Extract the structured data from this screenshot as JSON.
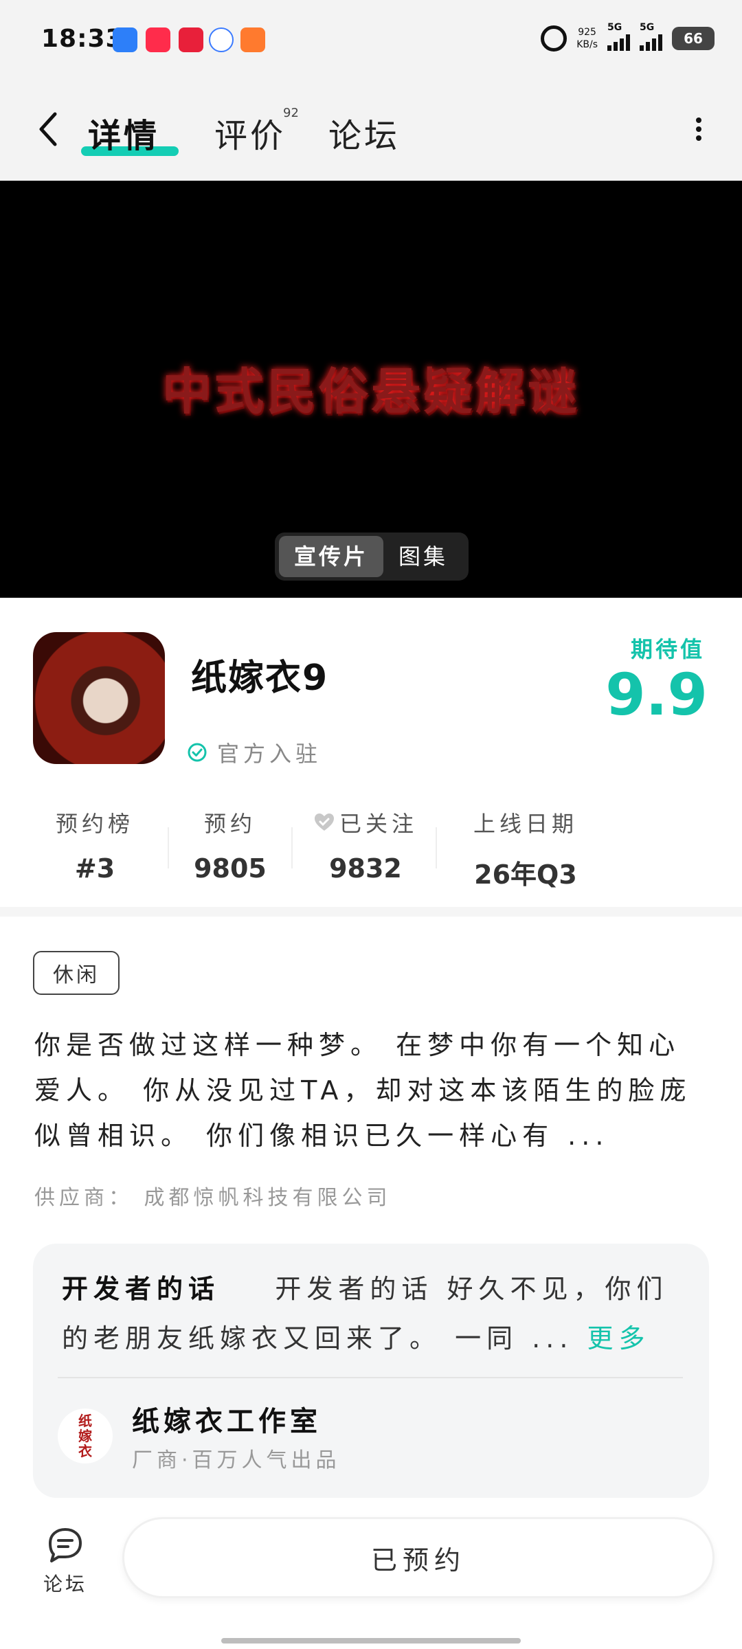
{
  "status_bar": {
    "time": "18:33",
    "net_speed": "925",
    "net_unit": "KB/s",
    "sig1_label": "5G",
    "sig2_label": "5G",
    "battery": "66"
  },
  "nav": {
    "tabs": [
      {
        "label": "详情",
        "active": true
      },
      {
        "label": "评价",
        "badge": "92"
      },
      {
        "label": "论坛"
      }
    ]
  },
  "video": {
    "title": "中式民俗悬疑解谜",
    "segments": [
      {
        "label": "宣传片",
        "active": true
      },
      {
        "label": "图集"
      }
    ]
  },
  "game": {
    "name": "纸嫁衣9",
    "official": "官方入驻",
    "expect_label": "期待值",
    "expect_score": "9.9"
  },
  "stats": [
    {
      "label": "预约榜",
      "value": "#3"
    },
    {
      "label": "预约",
      "value": "9805"
    },
    {
      "label": "已关注",
      "value": "9832",
      "icon": "heart-icon"
    },
    {
      "label": "上线日期",
      "value": "26年Q3"
    }
  ],
  "tag": "休闲",
  "description": "你是否做过这样一种梦。 在梦中你有一个知心爱人。 你从没见过TA，却对这本该陌生的脸庞似曾相识。 你们像相识已久一样心有 ...",
  "supplier": "供应商：  成都惊帆科技有限公司",
  "developer": {
    "heading": "开发者的话",
    "text": "开发者的话 好久不见，你们的老朋友纸嫁衣又回来了。 一同 ...",
    "more": "更多",
    "studio_logo_text": "纸嫁衣",
    "studio_name": "纸嫁衣工作室",
    "studio_sub": "厂商·百万人气出品"
  },
  "bottom": {
    "forum_label": "论坛",
    "reserve_label": "已预约"
  },
  "colors": {
    "accent": "#14c3ab",
    "video_bg": "#000000"
  }
}
